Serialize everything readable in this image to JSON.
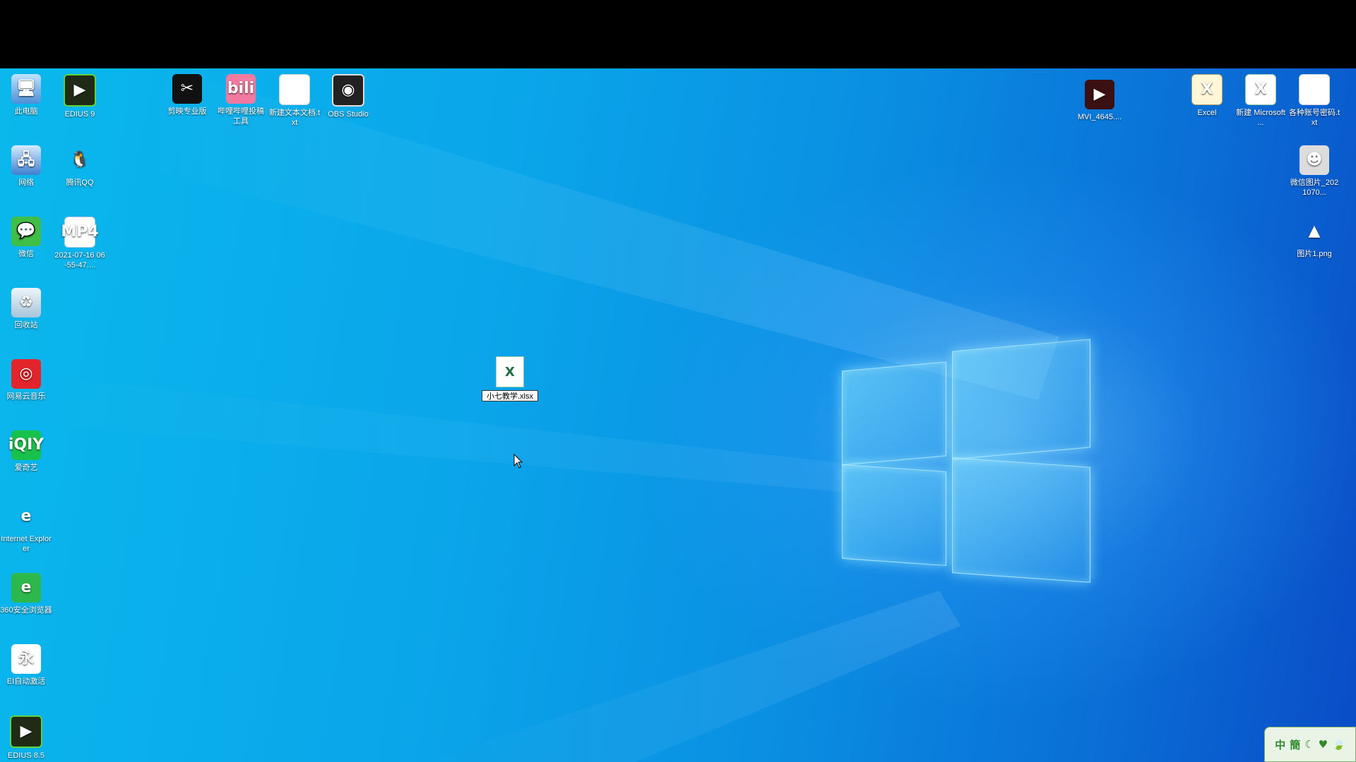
{
  "desktop": {
    "left_icons": [
      {
        "name": "this-pc",
        "label": "此电脑",
        "glyph": "🖥",
        "cls": "g-pc"
      },
      {
        "name": "edius9",
        "label": "EDIUS 9",
        "glyph": "▶",
        "cls": "g-edius"
      },
      {
        "name": "network",
        "label": "网络",
        "glyph": "🖧",
        "cls": "g-net"
      },
      {
        "name": "tencent-qq",
        "label": "腾讯QQ",
        "glyph": "🐧",
        "cls": "g-qq"
      },
      {
        "name": "wechat",
        "label": "微信",
        "glyph": "💬",
        "cls": "g-wechat"
      },
      {
        "name": "mp4-file",
        "label": "2021-07-16 06-55-47....",
        "glyph": "MP4",
        "cls": "g-mp4"
      },
      {
        "name": "recycle-bin",
        "label": "回收站",
        "glyph": "♻",
        "cls": "g-bin"
      },
      {
        "name": "netease-music",
        "label": "网易云音乐",
        "glyph": "◎",
        "cls": "g-music"
      },
      {
        "name": "iqiyi",
        "label": "爱奇艺",
        "glyph": "iQIY",
        "cls": "g-iqiyi"
      },
      {
        "name": "internet-explorer",
        "label": "Internet Explorer",
        "glyph": "e",
        "cls": "g-ie"
      },
      {
        "name": "360-browser",
        "label": "360安全浏览器",
        "glyph": "e",
        "cls": "g-360"
      },
      {
        "name": "ei-driver",
        "label": "EI自动激活",
        "glyph": "永",
        "cls": "g-yong"
      },
      {
        "name": "edius85",
        "label": "EDIUS 8.5",
        "glyph": "▶",
        "cls": "g-edius"
      }
    ],
    "top_icons": [
      {
        "name": "capcut",
        "label": "剪映专业版",
        "glyph": "✂",
        "cls": "g-capcut"
      },
      {
        "name": "bilibili-tool",
        "label": "哔哩哔哩投稿工具",
        "glyph": "bili",
        "cls": "g-bili"
      },
      {
        "name": "new-text-file",
        "label": "新建文本文档.txt",
        "glyph": "",
        "cls": "g-file"
      },
      {
        "name": "obs-studio",
        "label": "OBS Studio",
        "glyph": "◉",
        "cls": "g-obs"
      }
    ],
    "right_icons": [
      {
        "name": "video-file",
        "label": "MVI_4645....",
        "glyph": "▶",
        "cls": "g-video"
      },
      {
        "name": "excel-app",
        "label": "Excel",
        "glyph": "X",
        "cls": "g-excelapp"
      },
      {
        "name": "new-excel",
        "label": "新建 Microsoft ...",
        "glyph": "X",
        "cls": "g-excel"
      },
      {
        "name": "accounts-txt",
        "label": "各种账号密码.txt",
        "glyph": "",
        "cls": "g-file"
      },
      {
        "name": "wechat-image",
        "label": "微信图片_2021070...",
        "glyph": "☻",
        "cls": "g-photo"
      },
      {
        "name": "image-png",
        "label": "图片1.png",
        "glyph": "▲",
        "cls": "g-png"
      }
    ],
    "renaming_file": {
      "glyph": "X",
      "value": "小七教学.xlsx"
    }
  },
  "ime": {
    "chars": [
      "中",
      "簡",
      "☾",
      "♥",
      "🍃"
    ]
  },
  "colors": {
    "desktop_light": "#0ab8ec",
    "desktop_dark": "#0a4cc6",
    "ime_green": "#2f8a2c"
  }
}
